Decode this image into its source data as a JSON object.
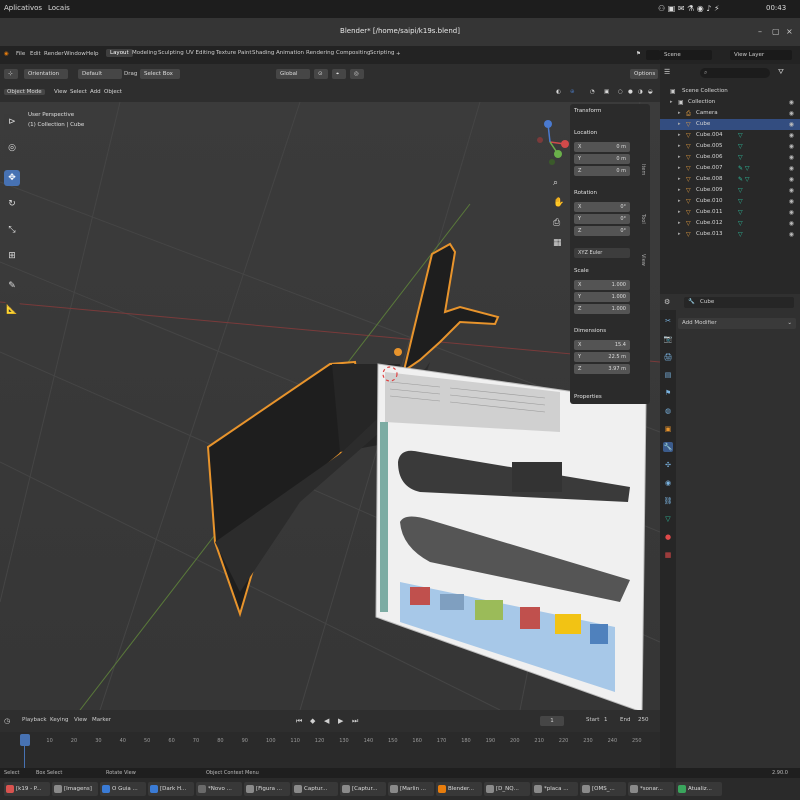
{
  "system_bar": {
    "apps_label": "Aplicativos",
    "places_label": "Locais",
    "clock": "00:43"
  },
  "window": {
    "title": "Blender* [/home/saipi/k19s.blend]"
  },
  "menu": {
    "items": [
      "File",
      "Edit",
      "Render",
      "Window",
      "Help"
    ],
    "workspaces": [
      "Layout",
      "Modeling",
      "Sculpting",
      "UV Editing",
      "Texture Paint",
      "Shading",
      "Animation",
      "Rendering",
      "Compositing",
      "Scripting"
    ],
    "add_workspace": "+",
    "scene": "Scene",
    "view_layer": "View Layer"
  },
  "tool_header": {
    "orientation": "Orientation",
    "default": "Default",
    "drag_label": "Drag",
    "drag_value": "Select Box",
    "transform": "Global",
    "options": "Options"
  },
  "mode_header": {
    "mode": "Object Mode",
    "view": "View",
    "select": "Select",
    "add": "Add",
    "object": "Object"
  },
  "viewport": {
    "perspective_label": "User Perspective",
    "collection_label": "(1) Collection | Cube"
  },
  "npanel": {
    "transform_title": "Transform",
    "location_label": "Location",
    "location": [
      {
        "k": "X",
        "v": "0 m"
      },
      {
        "k": "Y",
        "v": "0 m"
      },
      {
        "k": "Z",
        "v": "0 m"
      }
    ],
    "rotation_label": "Rotation",
    "rotation": [
      {
        "k": "X",
        "v": "0°"
      },
      {
        "k": "Y",
        "v": "0°"
      },
      {
        "k": "Z",
        "v": "0°"
      }
    ],
    "rotation_mode": "XYZ Euler",
    "scale_label": "Scale",
    "scale": [
      {
        "k": "X",
        "v": "1.000"
      },
      {
        "k": "Y",
        "v": "1.000"
      },
      {
        "k": "Z",
        "v": "1.000"
      }
    ],
    "dimensions_label": "Dimensions",
    "dimensions": [
      {
        "k": "X",
        "v": "15.4"
      },
      {
        "k": "Y",
        "v": "22.5 m"
      },
      {
        "k": "Z",
        "v": "3.97 m"
      }
    ],
    "properties_title": "Properties",
    "side_tabs": [
      "Item",
      "Tool",
      "View"
    ]
  },
  "outliner": {
    "title": "Scene Collection",
    "rows": [
      {
        "name": "Collection",
        "depth": 1,
        "icon": "collection-icon",
        "selected": false,
        "modifiers": ""
      },
      {
        "name": "Camera",
        "depth": 2,
        "icon": "camera-icon",
        "selected": false,
        "modifiers": ""
      },
      {
        "name": "Cube",
        "depth": 2,
        "icon": "mesh-icon",
        "selected": true,
        "modifiers": ""
      },
      {
        "name": "Cube.004",
        "depth": 2,
        "icon": "mesh-icon",
        "selected": false,
        "modifiers": "▽"
      },
      {
        "name": "Cube.005",
        "depth": 2,
        "icon": "mesh-icon",
        "selected": false,
        "modifiers": "▽"
      },
      {
        "name": "Cube.006",
        "depth": 2,
        "icon": "mesh-icon",
        "selected": false,
        "modifiers": "▽"
      },
      {
        "name": "Cube.007",
        "depth": 2,
        "icon": "mesh-icon",
        "selected": false,
        "modifiers": "✎ ▽"
      },
      {
        "name": "Cube.008",
        "depth": 2,
        "icon": "mesh-icon",
        "selected": false,
        "modifiers": "✎ ▽"
      },
      {
        "name": "Cube.009",
        "depth": 2,
        "icon": "mesh-icon",
        "selected": false,
        "modifiers": "▽"
      },
      {
        "name": "Cube.010",
        "depth": 2,
        "icon": "mesh-icon",
        "selected": false,
        "modifiers": "▽"
      },
      {
        "name": "Cube.011",
        "depth": 2,
        "icon": "mesh-icon",
        "selected": false,
        "modifiers": "▽"
      },
      {
        "name": "Cube.012",
        "depth": 2,
        "icon": "mesh-icon",
        "selected": false,
        "modifiers": "▽"
      },
      {
        "name": "Cube.013",
        "depth": 2,
        "icon": "mesh-icon",
        "selected": false,
        "modifiers": "▽"
      }
    ]
  },
  "properties": {
    "object_name": "Cube",
    "add_modifier": "Add Modifier"
  },
  "timeline": {
    "menu": [
      "Playback",
      "Keying",
      "View",
      "Marker"
    ],
    "current_frame": "1",
    "start_label": "Start",
    "start": "1",
    "end_label": "End",
    "end": "250",
    "ticks": [
      "0",
      "10",
      "20",
      "30",
      "40",
      "50",
      "60",
      "70",
      "80",
      "90",
      "100",
      "110",
      "120",
      "130",
      "140",
      "150",
      "160",
      "170",
      "180",
      "190",
      "200",
      "210",
      "220",
      "230",
      "240",
      "250"
    ]
  },
  "status_bar": {
    "select": "Select",
    "box_select": "Box Select",
    "rotate_view": "Rotate View",
    "context_menu": "Object Context Menu",
    "version": "2.90.0"
  },
  "taskbar": [
    {
      "label": "[k19 - P...",
      "color": "#d9534f"
    },
    {
      "label": "[Imagens]",
      "color": "#8a8a8a"
    },
    {
      "label": "O Guia ...",
      "color": "#3a7bd5"
    },
    {
      "label": "[Dark H...",
      "color": "#3a7bd5"
    },
    {
      "label": "*Novo ...",
      "color": "#6a6a6a"
    },
    {
      "label": "[Figura ...",
      "color": "#8a8a8a"
    },
    {
      "label": "Captur...",
      "color": "#8a8a8a"
    },
    {
      "label": "[Captur...",
      "color": "#8a8a8a"
    },
    {
      "label": "[Marlin ...",
      "color": "#8a8a8a"
    },
    {
      "label": "Blender...",
      "color": "#e87d0d"
    },
    {
      "label": "[D_NQ...",
      "color": "#8a8a8a"
    },
    {
      "label": "*placa ...",
      "color": "#8a8a8a"
    },
    {
      "label": "[OMS_...",
      "color": "#8a8a8a"
    },
    {
      "label": "*sonar...",
      "color": "#8a8a8a"
    },
    {
      "label": "Atualiz...",
      "color": "#3aa55d"
    }
  ],
  "colors": {
    "accent": "#4772b3",
    "selection_outline": "#e8942c",
    "outliner_selected": "#334d80"
  }
}
